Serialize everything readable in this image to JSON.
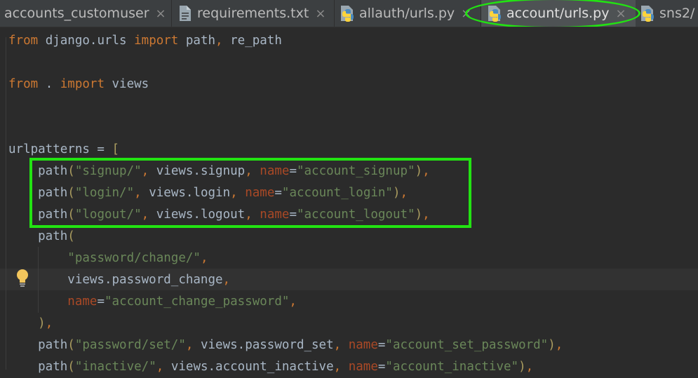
{
  "tabs": [
    {
      "label": "accounts_customuser",
      "close": "×",
      "active": false,
      "icon": "table-icon"
    },
    {
      "label": "requirements.txt",
      "close": "×",
      "active": false,
      "icon": "text-file-icon"
    },
    {
      "label": "allauth/urls.py",
      "close": "×",
      "active": false,
      "icon": "python-file-icon"
    },
    {
      "label": "account/urls.py",
      "close": "×",
      "active": true,
      "icon": "python-file-icon"
    },
    {
      "label": "sns2/",
      "close": "",
      "active": false,
      "icon": "python-file-icon"
    }
  ],
  "annotation_color": "#22e312",
  "code_lines": [
    [
      {
        "t": "from",
        "c": "kw"
      },
      {
        "t": " django.urls ",
        "c": "op"
      },
      {
        "t": "import",
        "c": "kw"
      },
      {
        "t": " path",
        "c": "op"
      },
      {
        "t": ",",
        "c": "kw"
      },
      {
        "t": " re_path",
        "c": "op"
      }
    ],
    [],
    [
      {
        "t": "from",
        "c": "kw"
      },
      {
        "t": " . ",
        "c": "op"
      },
      {
        "t": "import",
        "c": "kw"
      },
      {
        "t": " views",
        "c": "op"
      }
    ],
    [],
    [],
    [
      {
        "t": "urlpatterns = ",
        "c": "op"
      },
      {
        "t": "[",
        "c": "par"
      }
    ],
    [
      {
        "t": "    path",
        "c": "op"
      },
      {
        "t": "(",
        "c": "par"
      },
      {
        "t": "\"signup/\"",
        "c": "str"
      },
      {
        "t": ",",
        "c": "kw"
      },
      {
        "t": " views.signup",
        "c": "op"
      },
      {
        "t": ",",
        "c": "kw"
      },
      {
        "t": " ",
        "c": "op"
      },
      {
        "t": "name",
        "c": "named"
      },
      {
        "t": "=",
        "c": "op"
      },
      {
        "t": "\"account_signup\"",
        "c": "str"
      },
      {
        "t": ")",
        "c": "par"
      },
      {
        "t": ",",
        "c": "kw"
      }
    ],
    [
      {
        "t": "    path",
        "c": "op"
      },
      {
        "t": "(",
        "c": "par"
      },
      {
        "t": "\"login/\"",
        "c": "str"
      },
      {
        "t": ",",
        "c": "kw"
      },
      {
        "t": " views.login",
        "c": "op"
      },
      {
        "t": ",",
        "c": "kw"
      },
      {
        "t": " ",
        "c": "op"
      },
      {
        "t": "name",
        "c": "named"
      },
      {
        "t": "=",
        "c": "op"
      },
      {
        "t": "\"account_login\"",
        "c": "str"
      },
      {
        "t": ")",
        "c": "par"
      },
      {
        "t": ",",
        "c": "kw"
      }
    ],
    [
      {
        "t": "    path",
        "c": "op"
      },
      {
        "t": "(",
        "c": "par"
      },
      {
        "t": "\"logout/\"",
        "c": "str"
      },
      {
        "t": ",",
        "c": "kw"
      },
      {
        "t": " views.logout",
        "c": "op"
      },
      {
        "t": ",",
        "c": "kw"
      },
      {
        "t": " ",
        "c": "op"
      },
      {
        "t": "name",
        "c": "named"
      },
      {
        "t": "=",
        "c": "op"
      },
      {
        "t": "\"account_logout\"",
        "c": "str"
      },
      {
        "t": ")",
        "c": "par"
      },
      {
        "t": ",",
        "c": "kw"
      }
    ],
    [
      {
        "t": "    path",
        "c": "op"
      },
      {
        "t": "(",
        "c": "par"
      }
    ],
    [
      {
        "t": "        ",
        "c": "op"
      },
      {
        "t": "\"password/change/\"",
        "c": "str"
      },
      {
        "t": ",",
        "c": "kw"
      }
    ],
    [
      {
        "t": "        views.password_change",
        "c": "op"
      },
      {
        "t": ",",
        "c": "kw"
      }
    ],
    [
      {
        "t": "        ",
        "c": "op"
      },
      {
        "t": "name",
        "c": "named"
      },
      {
        "t": "=",
        "c": "op"
      },
      {
        "t": "\"account_change_password\"",
        "c": "str"
      },
      {
        "t": ",",
        "c": "kw"
      }
    ],
    [
      {
        "t": "    ",
        "c": "op"
      },
      {
        "t": ")",
        "c": "par"
      },
      {
        "t": ",",
        "c": "kw"
      }
    ],
    [
      {
        "t": "    path",
        "c": "op"
      },
      {
        "t": "(",
        "c": "par"
      },
      {
        "t": "\"password/set/\"",
        "c": "str"
      },
      {
        "t": ",",
        "c": "kw"
      },
      {
        "t": " views.password_set",
        "c": "op"
      },
      {
        "t": ",",
        "c": "kw"
      },
      {
        "t": " ",
        "c": "op"
      },
      {
        "t": "name",
        "c": "named"
      },
      {
        "t": "=",
        "c": "op"
      },
      {
        "t": "\"account_set_password\"",
        "c": "str"
      },
      {
        "t": ")",
        "c": "par"
      },
      {
        "t": ",",
        "c": "kw"
      }
    ],
    [
      {
        "t": "    path",
        "c": "op"
      },
      {
        "t": "(",
        "c": "par"
      },
      {
        "t": "\"inactive/\"",
        "c": "str"
      },
      {
        "t": ",",
        "c": "kw"
      },
      {
        "t": " views.account_inactive",
        "c": "op"
      },
      {
        "t": ",",
        "c": "kw"
      },
      {
        "t": " ",
        "c": "op"
      },
      {
        "t": "name",
        "c": "named"
      },
      {
        "t": "=",
        "c": "op"
      },
      {
        "t": "\"account_inactive\"",
        "c": "str"
      },
      {
        "t": ")",
        "c": "par"
      },
      {
        "t": ",",
        "c": "kw"
      }
    ]
  ],
  "intention_icon": "lightbulb-icon"
}
